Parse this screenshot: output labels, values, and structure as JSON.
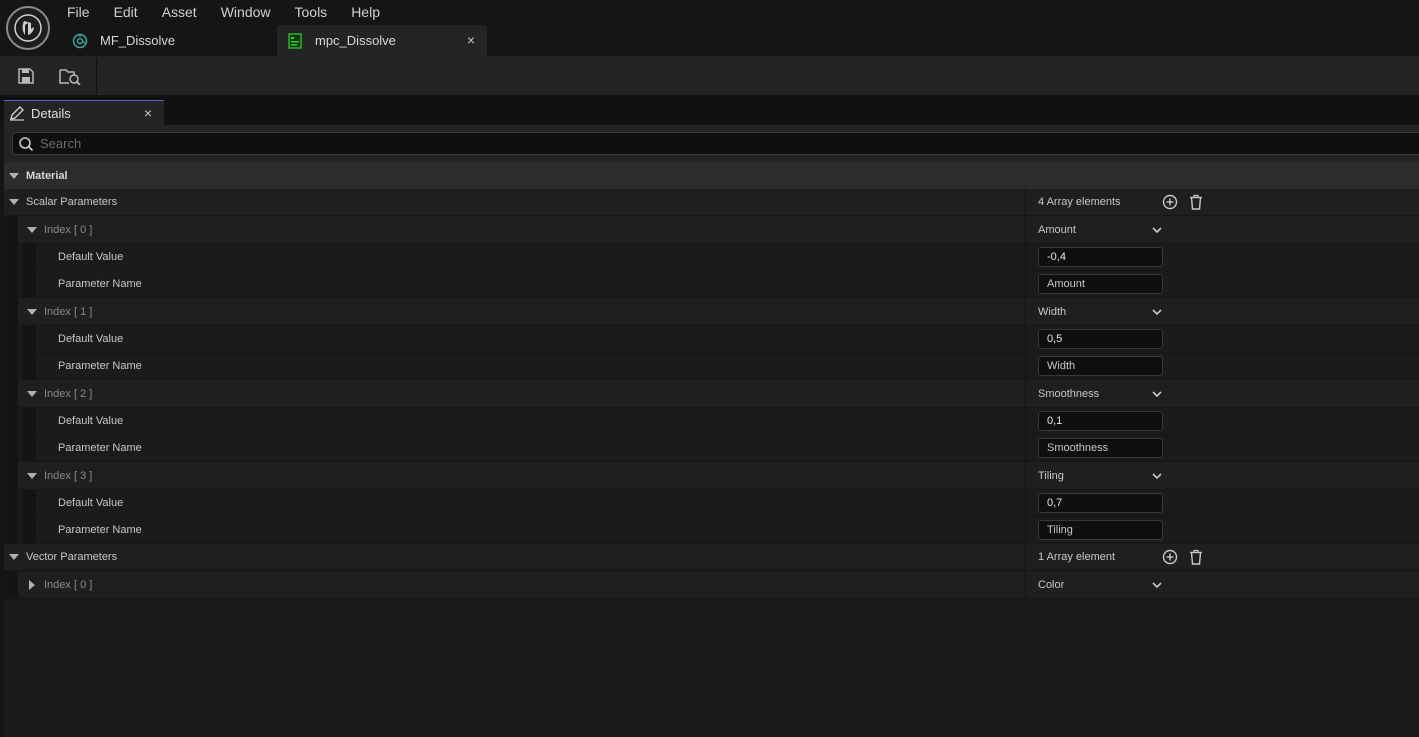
{
  "menu": [
    "File",
    "Edit",
    "Asset",
    "Window",
    "Tools",
    "Help"
  ],
  "tabs": [
    {
      "label": "MF_Dissolve",
      "icon": "material-function-icon",
      "active": false
    },
    {
      "label": "mpc_Dissolve",
      "icon": "material-parameter-collection-icon",
      "active": true,
      "close": "×"
    }
  ],
  "toolbar": {
    "buttons": [
      "save-icon",
      "browse-icon"
    ]
  },
  "details": {
    "tab_label": "Details",
    "close": "×",
    "search_placeholder": "Search",
    "category": "Material",
    "scalar": {
      "label": "Scalar Parameters",
      "count": "4 Array elements",
      "items": [
        {
          "index": "Index [ 0 ]",
          "name": "Amount",
          "default_label": "Default Value",
          "default": "-0,4",
          "param_label": "Parameter Name",
          "param": "Amount"
        },
        {
          "index": "Index [ 1 ]",
          "name": "Width",
          "default_label": "Default Value",
          "default": "0,5",
          "param_label": "Parameter Name",
          "param": "Width"
        },
        {
          "index": "Index [ 2 ]",
          "name": "Smoothness",
          "default_label": "Default Value",
          "default": "0,1",
          "param_label": "Parameter Name",
          "param": "Smoothness"
        },
        {
          "index": "Index [ 3 ]",
          "name": "Tiling",
          "default_label": "Default Value",
          "default": "0,7",
          "param_label": "Parameter Name",
          "param": "Tiling"
        }
      ]
    },
    "vector": {
      "label": "Vector Parameters",
      "count": "1 Array element",
      "items": [
        {
          "index": "Index [ 0 ]",
          "name": "Color"
        }
      ]
    }
  },
  "colors": {
    "accent": "#3e6fc0",
    "bg": "#151515",
    "panel": "#1a1a1a"
  }
}
